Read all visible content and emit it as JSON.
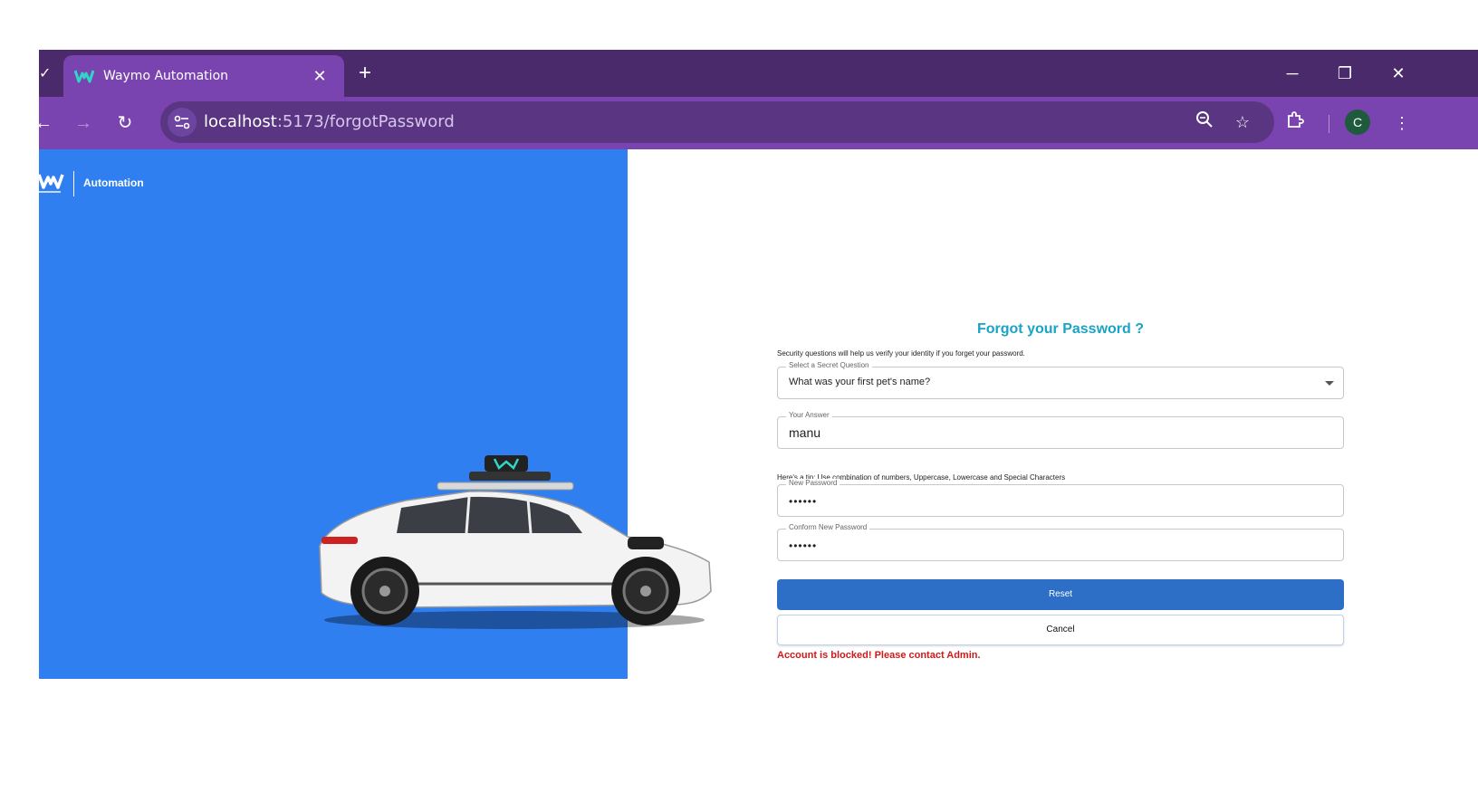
{
  "browser": {
    "tab_title": "Waymo Automation",
    "tab_close": "✕",
    "new_tab": "+",
    "url_host": "localhost",
    "url_path": ":5173/forgotPassword",
    "profile_initial": "C"
  },
  "page": {
    "brand_text": "Automation",
    "title": "Forgot your Password ?",
    "subtitle": "Security questions will help us verify your identity if you forget your password.",
    "question": {
      "label": "Select a Secret Question",
      "value": "What was your first pet's name?"
    },
    "answer": {
      "label": "Your Answer",
      "value": "manu"
    },
    "tip": "Here's a tip: Use combination of numbers, Uppercase, Lowercase and Special Characters",
    "new_password": {
      "label": "New Password",
      "value": "••••••"
    },
    "confirm_password": {
      "label": "Conform New Password",
      "value": "••••••"
    },
    "reset_label": "Reset",
    "cancel_label": "Cancel",
    "error_message": "Account is blocked! Please contact Admin."
  },
  "colors": {
    "hero_blue": "#2f7ff0",
    "title_teal": "#1aa3c5",
    "reset_blue": "#2d6fc7",
    "error_red": "#d41818",
    "chrome_purple": "#7a44b0"
  }
}
